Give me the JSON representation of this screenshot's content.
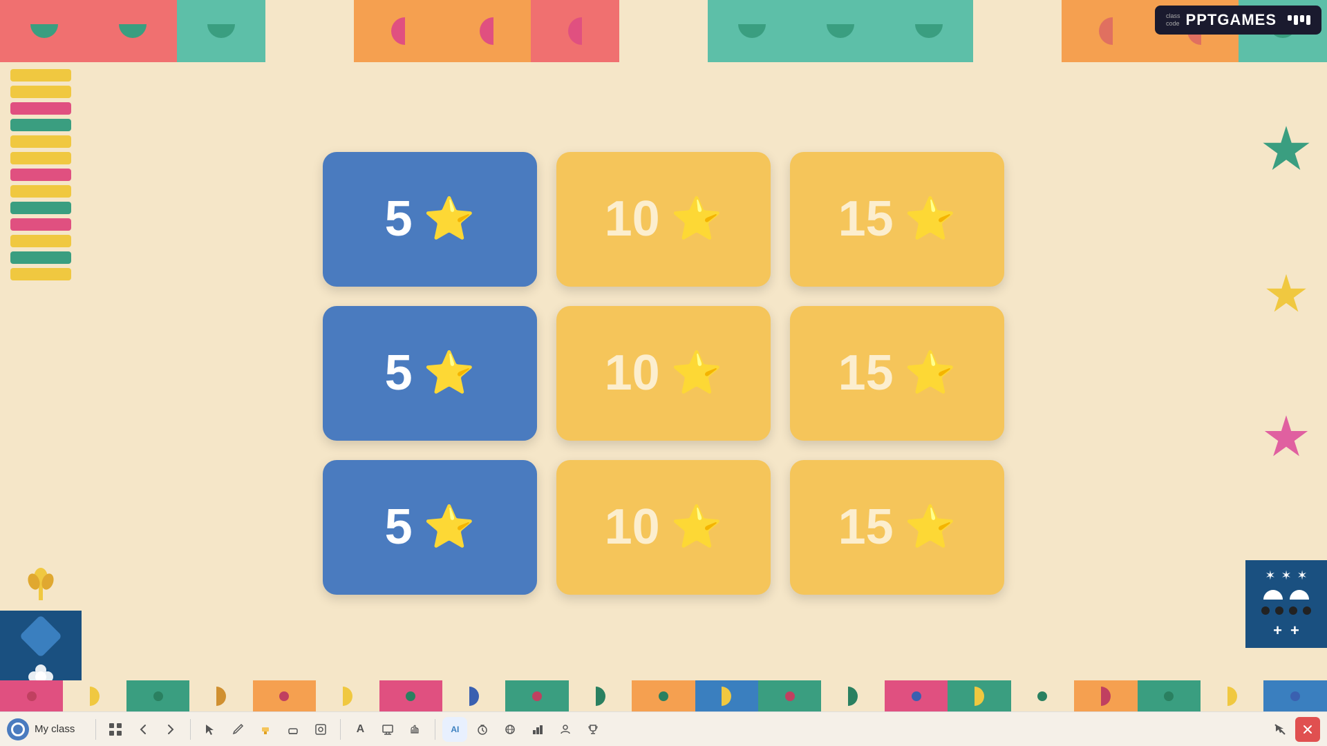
{
  "app": {
    "title": "PPTGAMES",
    "subtitle_line1": "class",
    "subtitle_line2": "code"
  },
  "bottom_bar": {
    "my_class_label": "My class"
  },
  "cards": [
    {
      "value": "5",
      "color": "blue",
      "row": 1,
      "col": 1
    },
    {
      "value": "10",
      "color": "yellow",
      "row": 1,
      "col": 2
    },
    {
      "value": "15",
      "color": "yellow",
      "row": 1,
      "col": 3
    },
    {
      "value": "5",
      "color": "blue",
      "row": 2,
      "col": 1
    },
    {
      "value": "10",
      "color": "yellow",
      "row": 2,
      "col": 2
    },
    {
      "value": "15",
      "color": "yellow",
      "row": 2,
      "col": 3
    },
    {
      "value": "5",
      "color": "blue",
      "row": 3,
      "col": 1
    },
    {
      "value": "10",
      "color": "yellow",
      "row": 3,
      "col": 2
    },
    {
      "value": "15",
      "color": "yellow",
      "row": 3,
      "col": 3
    }
  ],
  "toolbar": {
    "buttons": [
      "⊞",
      "←",
      "→",
      "↖",
      "✏",
      "🖊",
      "◻",
      "⌘",
      "A",
      "▣",
      "✋",
      "AI",
      "⏱",
      "🌐",
      "📊",
      "👤",
      "🏆"
    ]
  }
}
